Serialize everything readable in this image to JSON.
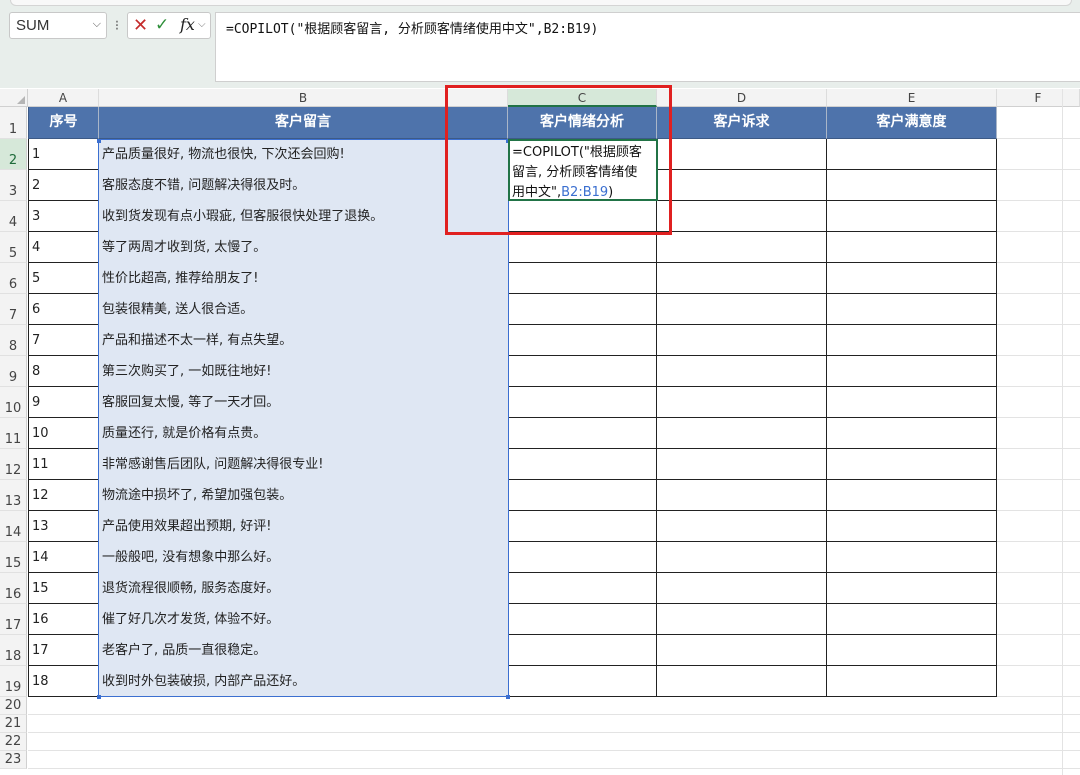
{
  "toolbar": {
    "name_box": "SUM",
    "kebab": "⁝",
    "cancel": "✕",
    "enter": "✓",
    "fx": "fx",
    "formula": "=COPILOT(\"根据顾客留言, 分析顾客情绪使用中文\",B2:B19)"
  },
  "columns": [
    "A",
    "B",
    "C",
    "D",
    "E",
    "F"
  ],
  "headers": [
    "序号",
    "客户留言",
    "客户情绪分析",
    "客户诉求",
    "客户满意度"
  ],
  "rows": [
    {
      "no": "1",
      "msg": "产品质量很好, 物流也很快, 下次还会回购!"
    },
    {
      "no": "2",
      "msg": "客服态度不错, 问题解决得很及时。"
    },
    {
      "no": "3",
      "msg": "收到货发现有点小瑕疵, 但客服很快处理了退换。"
    },
    {
      "no": "4",
      "msg": "等了两周才收到货, 太慢了。"
    },
    {
      "no": "5",
      "msg": "性价比超高, 推荐给朋友了!"
    },
    {
      "no": "6",
      "msg": "包装很精美, 送人很合适。"
    },
    {
      "no": "7",
      "msg": "产品和描述不太一样, 有点失望。"
    },
    {
      "no": "8",
      "msg": "第三次购买了, 一如既往地好!"
    },
    {
      "no": "9",
      "msg": "客服回复太慢, 等了一天才回。"
    },
    {
      "no": "10",
      "msg": "质量还行, 就是价格有点贵。"
    },
    {
      "no": "11",
      "msg": "非常感谢售后团队, 问题解决得很专业!"
    },
    {
      "no": "12",
      "msg": "物流途中损坏了, 希望加强包装。"
    },
    {
      "no": "13",
      "msg": "产品使用效果超出预期, 好评!"
    },
    {
      "no": "14",
      "msg": "一般般吧, 没有想象中那么好。"
    },
    {
      "no": "15",
      "msg": "退货流程很顺畅, 服务态度好。"
    },
    {
      "no": "16",
      "msg": "催了好几次才发货, 体验不好。"
    },
    {
      "no": "17",
      "msg": "老客户了, 品质一直很稳定。"
    },
    {
      "no": "18",
      "msg": "收到时外包装破损, 内部产品还好。"
    }
  ],
  "row_numbers": [
    "1",
    "2",
    "3",
    "4",
    "5",
    "6",
    "7",
    "8",
    "9",
    "10",
    "11",
    "12",
    "13",
    "14",
    "15",
    "16",
    "17",
    "18",
    "19",
    "20",
    "21",
    "22",
    "23"
  ],
  "editing_cell": {
    "line1": "=COPILOT(\"根据顾客",
    "line2": "留言, 分析顾客情绪使",
    "line3_text": "用中文\",",
    "line3_ref": "B2:B19",
    "line3_close": ")"
  },
  "colors": {
    "header_fill": "#4e73ab",
    "range_fill": "#dfe7f3",
    "highlight_box": "#e02020",
    "excel_green": "#217346"
  }
}
